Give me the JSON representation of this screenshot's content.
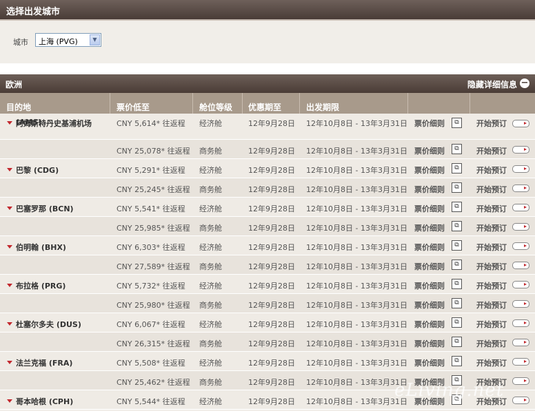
{
  "page_title": "选择出发城市",
  "city": {
    "label": "城市",
    "selected": "上海 (PVG)"
  },
  "region": {
    "name": "欧洲",
    "toggle_label": "隐藏详细信息",
    "toggle_icon": "minus-circle-icon"
  },
  "columns": [
    "目的地",
    "票价低至",
    "舱位等级",
    "优惠期至",
    "出发期限"
  ],
  "rows": [
    {
      "dest": "阿姆斯特丹史基浦机场",
      "dest_code": "(AMS)",
      "price": "CNY 5,614* 往返程",
      "cabin": "经济舱",
      "promo": "12年9月28日",
      "travel": "12年10月8日 - 13年3月31日",
      "detail": "票价细则",
      "book": "开始预订"
    },
    {
      "dest": "",
      "dest_code": "",
      "price": "CNY 25,078* 往返程",
      "cabin": "商务舱",
      "promo": "12年9月28日",
      "travel": "12年10月8日 - 13年3月31日",
      "detail": "票价细则",
      "book": "开始预订"
    },
    {
      "dest": "巴黎 (CDG)",
      "dest_code": "",
      "price": "CNY 5,291* 往返程",
      "cabin": "经济舱",
      "promo": "12年9月28日",
      "travel": "12年10月8日 - 13年3月31日",
      "detail": "票价细则",
      "book": "开始预订"
    },
    {
      "dest": "",
      "dest_code": "",
      "price": "CNY 25,245* 往返程",
      "cabin": "商务舱",
      "promo": "12年9月28日",
      "travel": "12年10月8日 - 13年3月31日",
      "detail": "票价细则",
      "book": "开始预订"
    },
    {
      "dest": "巴塞罗那 (BCN)",
      "dest_code": "",
      "price": "CNY 5,541* 往返程",
      "cabin": "经济舱",
      "promo": "12年9月28日",
      "travel": "12年10月8日 - 13年3月31日",
      "detail": "票价细则",
      "book": "开始预订"
    },
    {
      "dest": "",
      "dest_code": "",
      "price": "CNY 25,985* 往返程",
      "cabin": "商务舱",
      "promo": "12年9月28日",
      "travel": "12年10月8日 - 13年3月31日",
      "detail": "票价细则",
      "book": "开始预订"
    },
    {
      "dest": "伯明翰 (BHX)",
      "dest_code": "",
      "price": "CNY 6,303* 往返程",
      "cabin": "经济舱",
      "promo": "12年9月28日",
      "travel": "12年10月8日 - 13年3月31日",
      "detail": "票价细则",
      "book": "开始预订"
    },
    {
      "dest": "",
      "dest_code": "",
      "price": "CNY 27,589* 往返程",
      "cabin": "商务舱",
      "promo": "12年9月28日",
      "travel": "12年10月8日 - 13年3月31日",
      "detail": "票价细则",
      "book": "开始预订"
    },
    {
      "dest": "布拉格 (PRG)",
      "dest_code": "",
      "price": "CNY 5,732* 往返程",
      "cabin": "经济舱",
      "promo": "12年9月28日",
      "travel": "12年10月8日 - 13年3月31日",
      "detail": "票价细则",
      "book": "开始预订"
    },
    {
      "dest": "",
      "dest_code": "",
      "price": "CNY 25,980* 往返程",
      "cabin": "商务舱",
      "promo": "12年9月28日",
      "travel": "12年10月8日 - 13年3月31日",
      "detail": "票价细则",
      "book": "开始预订"
    },
    {
      "dest": "杜塞尔多夫 (DUS)",
      "dest_code": "",
      "price": "CNY 6,067* 往返程",
      "cabin": "经济舱",
      "promo": "12年9月28日",
      "travel": "12年10月8日 - 13年3月31日",
      "detail": "票价细则",
      "book": "开始预订"
    },
    {
      "dest": "",
      "dest_code": "",
      "price": "CNY 26,315* 往返程",
      "cabin": "商务舱",
      "promo": "12年9月28日",
      "travel": "12年10月8日 - 13年3月31日",
      "detail": "票价细则",
      "book": "开始预订"
    },
    {
      "dest": "法兰克福 (FRA)",
      "dest_code": "",
      "price": "CNY 5,508* 往返程",
      "cabin": "经济舱",
      "promo": "12年9月28日",
      "travel": "12年10月8日 - 13年3月31日",
      "detail": "票价细则",
      "book": "开始预订"
    },
    {
      "dest": "",
      "dest_code": "",
      "price": "CNY 25,462* 往返程",
      "cabin": "商务舱",
      "promo": "12年9月28日",
      "travel": "12年10月8日 - 13年3月31日",
      "detail": "票价细则",
      "book": "开始预订"
    },
    {
      "dest": "哥本哈根 (CPH)",
      "dest_code": "",
      "price": "CNY 5,544* 往返程",
      "cabin": "经济舱",
      "promo": "12年9月28日",
      "travel": "12年10月8日 - 13年3月31日",
      "detail": "票价细则",
      "book": "开始预订"
    }
  ],
  "icons": {
    "detail": "popup-window-icon",
    "book": "arrow-right-button-icon",
    "row_marker": "red-triangle-down-icon"
  },
  "watermark": "eLiving.net"
}
